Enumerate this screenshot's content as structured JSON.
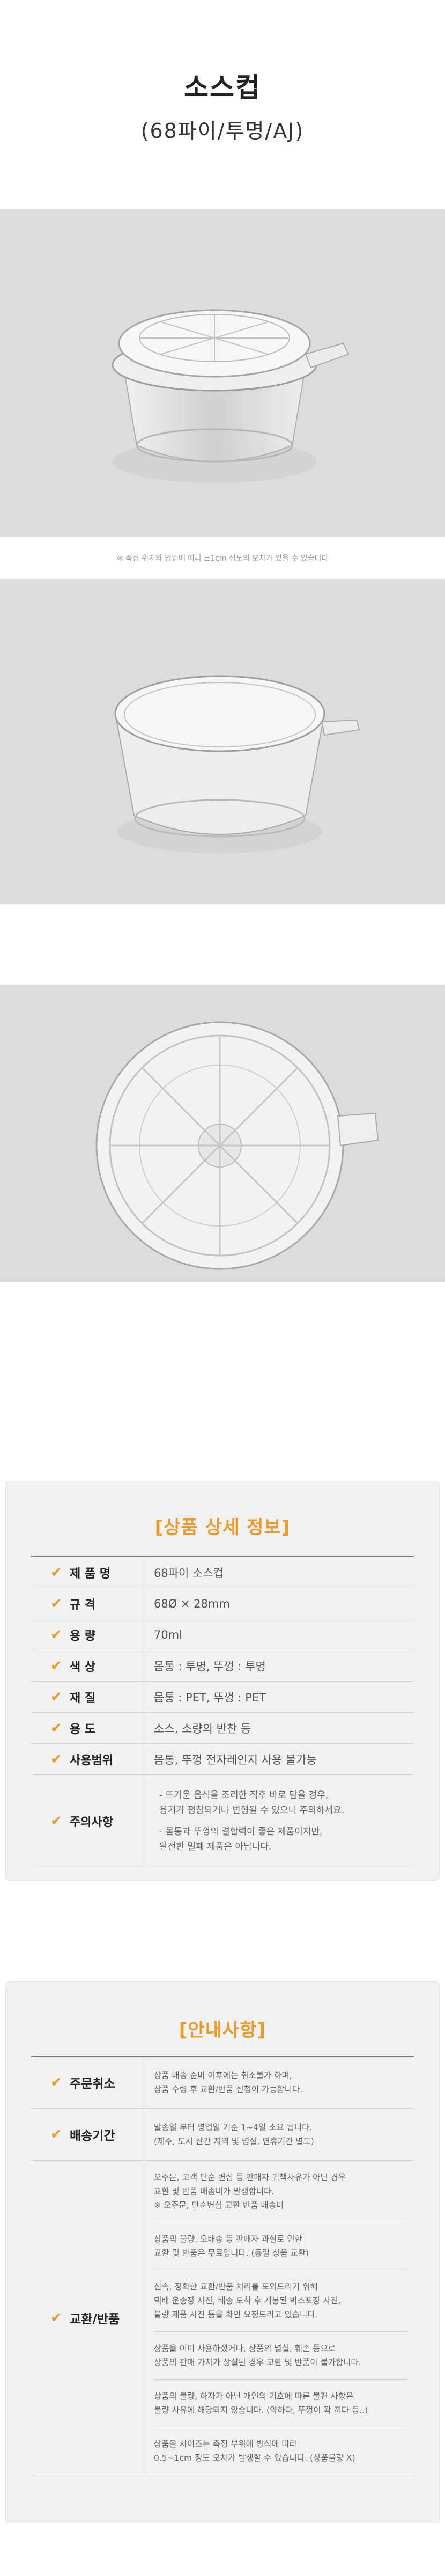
{
  "header": {
    "title": "소스컵",
    "subtitle": "(68파이/투명/AJ)"
  },
  "photo_caption": "※ 측정 위치와 방법에 따라 ±1cm 정도의 오차가 있을 수 있습니다",
  "spec": {
    "title": "[상품 상세 정보]",
    "rows": [
      {
        "key": "제 품 명",
        "value": "68파이 소스컵"
      },
      {
        "key": "규    격",
        "value": "68Ø × 28mm"
      },
      {
        "key": "용    량",
        "value": "70ml"
      },
      {
        "key": "색    상",
        "value": "몸통 : 투명, 뚜껑 : 투명"
      },
      {
        "key": "재    질",
        "value": "몸통 : PET, 뚜껑 : PET"
      },
      {
        "key": "용    도",
        "value": "소스, 소량의 반찬 등"
      },
      {
        "key": "사용범위",
        "value": "몸통, 뚜껑 전자레인지 사용 불가능"
      }
    ],
    "caution": {
      "key": "주의사항",
      "notes": [
        "- 뜨거운 음식을 조리한 직후 바로 담을 경우,",
        "  용기가 평창되거나 변형될 수 있으니 주의하세요.",
        "- 몸통과 뚜껑의 결합력이 좋은 제품이지만,",
        "  완전한 밀폐 제품은 아닙니다."
      ]
    }
  },
  "notice": {
    "title": "[안내사항]",
    "rows": [
      {
        "key": "주문취소",
        "blocks": [
          [
            "상품 배송 준비 이후에는 취소불가 하며,",
            "상품 수령 후 교환/반품 신청이 가능합니다."
          ]
        ]
      },
      {
        "key": "배송기간",
        "blocks": [
          [
            "발송일 부터 영업일 기준 1~4일 소요 됩니다.",
            "(제주, 도서 산간 지역 및 명절, 연휴기간 별도)"
          ]
        ]
      },
      {
        "key": "교환/반품",
        "blocks": [
          [
            "오주문, 고객 단순 변심 등 판매자 귀책사유가 아닌 경우",
            "교환 및 반품 배송비가 발생합니다.",
            "※ 오주문, 단순변심 교환 반품 배송비"
          ],
          [
            "상품의 불량, 오배송 등 판매자 과실로 인한",
            "교환 및 반품은 무료입니다. (동일 상품 교환)"
          ],
          [
            "신속, 정확한 교환/반품 처리를 도와드리기 위해",
            "택배 운송장 사진, 배송 도착 후 개봉된 박스포장 사진,",
            "불량 제품 사진 등을 확인 요청드리고 있습니다."
          ],
          [
            "상품을 이미 사용하셨거나, 상품의 멸실, 훼손 등으로",
            "상품의 판매 가치가 상실된 경우 교환 및 반품이 불가합니다."
          ],
          [
            "상품의 불량, 하자가 아닌 개인의 기호에 따른 불편 사항은",
            "불량 사유에 해당되지 않습니다. (약하다, 뚜껑이 꽉 끼다 등..)"
          ],
          [
            "상품을 사이즈는 측정 부위에 방식에 따라",
            "0.5~1cm 정도 오차가 발생할 수 있습니다. (상품불량 X)"
          ]
        ]
      }
    ]
  },
  "colors": {
    "accent": "#e89a2c",
    "photo_bg": "#dcdcdc",
    "panel_bg": "#f1f1f1"
  }
}
